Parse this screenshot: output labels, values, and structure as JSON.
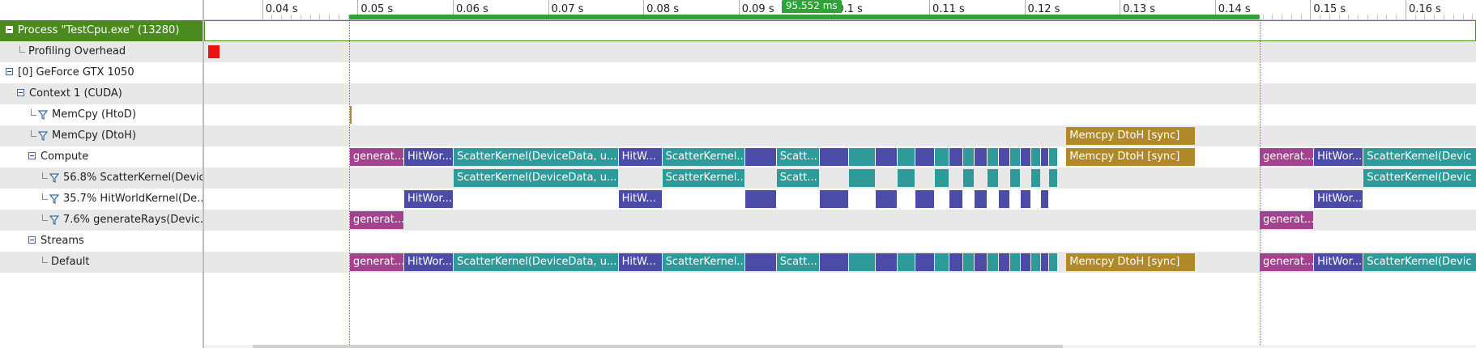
{
  "tree": {
    "rows": [
      {
        "name": "process-row",
        "label": "Process \"TestCpu.exe\" (13280)",
        "toggle": true,
        "filter": false,
        "indent": 0,
        "selected": true,
        "alt": false
      },
      {
        "name": "profiling-overhead-row",
        "label": "Profiling Overhead",
        "toggle": false,
        "filter": false,
        "indent": 1,
        "selected": false,
        "alt": true
      },
      {
        "name": "gpu-row",
        "label": "[0] GeForce GTX 1050",
        "toggle": true,
        "filter": false,
        "indent": 0,
        "selected": false,
        "alt": false
      },
      {
        "name": "context-row",
        "label": "Context 1 (CUDA)",
        "toggle": true,
        "filter": false,
        "indent": 1,
        "selected": false,
        "alt": true
      },
      {
        "name": "memcpy-htod-row",
        "label": "MemCpy (HtoD)",
        "toggle": false,
        "filter": true,
        "indent": 2,
        "selected": false,
        "alt": false
      },
      {
        "name": "memcpy-dtoh-row",
        "label": "MemCpy (DtoH)",
        "toggle": false,
        "filter": true,
        "indent": 2,
        "selected": false,
        "alt": true
      },
      {
        "name": "compute-row",
        "label": "Compute",
        "toggle": true,
        "filter": false,
        "indent": 2,
        "selected": false,
        "alt": false
      },
      {
        "name": "scatter-kernel-row",
        "label": "56.8% ScatterKernel(Devic...",
        "toggle": false,
        "filter": true,
        "indent": 3,
        "selected": false,
        "alt": true
      },
      {
        "name": "hitworld-kernel-row",
        "label": "35.7% HitWorldKernel(De...",
        "toggle": false,
        "filter": true,
        "indent": 3,
        "selected": false,
        "alt": false
      },
      {
        "name": "generate-rays-row",
        "label": "7.6% generateRays(Devic...",
        "toggle": false,
        "filter": true,
        "indent": 3,
        "selected": false,
        "alt": true
      },
      {
        "name": "streams-row",
        "label": "Streams",
        "toggle": true,
        "filter": false,
        "indent": 2,
        "selected": false,
        "alt": false
      },
      {
        "name": "default-stream-row",
        "label": "Default",
        "toggle": false,
        "filter": false,
        "indent": 3,
        "selected": false,
        "alt": true
      }
    ]
  },
  "ruler": {
    "ticks": [
      "0.04 s",
      "0.05 s",
      "0.06 s",
      "0.07 s",
      "0.08 s",
      "0.09 s",
      "0.1 s",
      "0.11 s",
      "0.12 s",
      "0.13 s",
      "0.14 s",
      "0.15 s",
      "0.16 s"
    ],
    "tick_values": [
      0.04,
      0.05,
      0.06,
      0.07,
      0.08,
      0.09,
      0.1,
      0.11,
      0.12,
      0.13,
      0.14,
      0.15,
      0.16
    ],
    "view_range_s": [
      0.0339,
      0.1674
    ],
    "selection": {
      "start_s": 0.0491,
      "end_s": 0.1447,
      "label": "95.552 ms"
    }
  },
  "colors": {
    "selected_row": "#4a8a20",
    "generate": "#a3438e",
    "hitworld": "#4c4ca8",
    "scatter": "#2f9a9a",
    "memcpy": "#b08a2a",
    "overhead": "#e11111",
    "selection": "#2fa33a"
  },
  "lanes": [
    {
      "name": "process-lane",
      "selected": true,
      "alt": false,
      "bars": []
    },
    {
      "name": "profiling-overhead-lane",
      "alt": true,
      "bars": [
        {
          "k": "oh",
          "s": 0.0343,
          "e": 0.0356,
          "t": ""
        }
      ]
    },
    {
      "name": "gpu-lane",
      "alt": false,
      "bars": []
    },
    {
      "name": "context-lane",
      "alt": true,
      "bars": []
    },
    {
      "name": "memcpy-htod-lane",
      "alt": false,
      "bars": [
        {
          "k": "m",
          "s": 0.0492,
          "e": 0.0494,
          "t": ""
        }
      ]
    },
    {
      "name": "memcpy-dtoh-lane",
      "alt": true,
      "bars": [
        {
          "k": "m",
          "s": 0.1244,
          "e": 0.138,
          "t": "Memcpy DtoH [sync]"
        }
      ]
    },
    {
      "name": "compute-lane",
      "alt": false,
      "bars": [
        {
          "k": "g",
          "s": 0.0492,
          "e": 0.0549,
          "t": "generat..."
        },
        {
          "k": "h",
          "s": 0.0549,
          "e": 0.0601,
          "t": "HitWor..."
        },
        {
          "k": "s",
          "s": 0.0601,
          "e": 0.0774,
          "t": "ScatterKernel(DeviceData, u..."
        },
        {
          "k": "h",
          "s": 0.0774,
          "e": 0.082,
          "t": "HitW..."
        },
        {
          "k": "s",
          "s": 0.082,
          "e": 0.0907,
          "t": "ScatterKernel..."
        },
        {
          "k": "h",
          "s": 0.0907,
          "e": 0.094,
          "t": ""
        },
        {
          "k": "s",
          "s": 0.094,
          "e": 0.0985,
          "t": "Scatt..."
        },
        {
          "k": "h",
          "s": 0.0985,
          "e": 0.1016,
          "t": ""
        },
        {
          "k": "s",
          "s": 0.1016,
          "e": 0.1044,
          "t": ""
        },
        {
          "k": "h",
          "s": 0.1044,
          "e": 0.1067,
          "t": ""
        },
        {
          "k": "s",
          "s": 0.1067,
          "e": 0.1086,
          "t": ""
        },
        {
          "k": "h",
          "s": 0.1086,
          "e": 0.1106,
          "t": ""
        },
        {
          "k": "s",
          "s": 0.1106,
          "e": 0.1121,
          "t": ""
        },
        {
          "k": "h",
          "s": 0.1121,
          "e": 0.1136,
          "t": ""
        },
        {
          "k": "s",
          "s": 0.1136,
          "e": 0.1148,
          "t": ""
        },
        {
          "k": "h",
          "s": 0.1148,
          "e": 0.1161,
          "t": ""
        },
        {
          "k": "s",
          "s": 0.1161,
          "e": 0.1173,
          "t": ""
        },
        {
          "k": "h",
          "s": 0.1173,
          "e": 0.1185,
          "t": ""
        },
        {
          "k": "s",
          "s": 0.1185,
          "e": 0.1196,
          "t": ""
        },
        {
          "k": "h",
          "s": 0.1196,
          "e": 0.1207,
          "t": ""
        },
        {
          "k": "s",
          "s": 0.1207,
          "e": 0.1217,
          "t": ""
        },
        {
          "k": "h",
          "s": 0.1217,
          "e": 0.1226,
          "t": ""
        },
        {
          "k": "s",
          "s": 0.1226,
          "e": 0.1235,
          "t": ""
        },
        {
          "k": "m",
          "s": 0.1244,
          "e": 0.138,
          "t": "Memcpy DtoH [sync]"
        },
        {
          "k": "g",
          "s": 0.1447,
          "e": 0.1504,
          "t": "generat..."
        },
        {
          "k": "h",
          "s": 0.1504,
          "e": 0.1556,
          "t": "HitWor..."
        },
        {
          "k": "s",
          "s": 0.1556,
          "e": 0.168,
          "t": "ScatterKernel(Devic"
        }
      ]
    },
    {
      "name": "scatter-kernel-lane",
      "alt": true,
      "bars": [
        {
          "k": "s",
          "s": 0.0601,
          "e": 0.0774,
          "t": "ScatterKernel(DeviceData, u..."
        },
        {
          "k": "s",
          "s": 0.082,
          "e": 0.0907,
          "t": "ScatterKernel..."
        },
        {
          "k": "s",
          "s": 0.094,
          "e": 0.0985,
          "t": "Scatt..."
        },
        {
          "k": "s",
          "s": 0.1016,
          "e": 0.1044,
          "t": ""
        },
        {
          "k": "s",
          "s": 0.1067,
          "e": 0.1086,
          "t": ""
        },
        {
          "k": "s",
          "s": 0.1106,
          "e": 0.1121,
          "t": ""
        },
        {
          "k": "s",
          "s": 0.1136,
          "e": 0.1148,
          "t": ""
        },
        {
          "k": "s",
          "s": 0.1161,
          "e": 0.1173,
          "t": ""
        },
        {
          "k": "s",
          "s": 0.1185,
          "e": 0.1196,
          "t": ""
        },
        {
          "k": "s",
          "s": 0.1207,
          "e": 0.1217,
          "t": ""
        },
        {
          "k": "s",
          "s": 0.1226,
          "e": 0.1235,
          "t": ""
        },
        {
          "k": "s",
          "s": 0.1556,
          "e": 0.168,
          "t": "ScatterKernel(Devic"
        }
      ]
    },
    {
      "name": "hitworld-kernel-lane",
      "alt": false,
      "bars": [
        {
          "k": "h",
          "s": 0.0549,
          "e": 0.0601,
          "t": "HitWor..."
        },
        {
          "k": "h",
          "s": 0.0774,
          "e": 0.082,
          "t": "HitW..."
        },
        {
          "k": "h",
          "s": 0.0907,
          "e": 0.094,
          "t": ""
        },
        {
          "k": "h",
          "s": 0.0985,
          "e": 0.1016,
          "t": ""
        },
        {
          "k": "h",
          "s": 0.1044,
          "e": 0.1067,
          "t": ""
        },
        {
          "k": "h",
          "s": 0.1086,
          "e": 0.1106,
          "t": ""
        },
        {
          "k": "h",
          "s": 0.1121,
          "e": 0.1136,
          "t": ""
        },
        {
          "k": "h",
          "s": 0.1148,
          "e": 0.1161,
          "t": ""
        },
        {
          "k": "h",
          "s": 0.1173,
          "e": 0.1185,
          "t": ""
        },
        {
          "k": "h",
          "s": 0.1196,
          "e": 0.1207,
          "t": ""
        },
        {
          "k": "h",
          "s": 0.1217,
          "e": 0.1226,
          "t": ""
        },
        {
          "k": "h",
          "s": 0.1504,
          "e": 0.1556,
          "t": "HitWor..."
        }
      ]
    },
    {
      "name": "generate-rays-lane",
      "alt": true,
      "bars": [
        {
          "k": "g",
          "s": 0.0492,
          "e": 0.0549,
          "t": "generat..."
        },
        {
          "k": "g",
          "s": 0.1447,
          "e": 0.1504,
          "t": "generat..."
        }
      ]
    },
    {
      "name": "streams-lane",
      "alt": false,
      "bars": []
    },
    {
      "name": "default-stream-lane",
      "alt": true,
      "bars": [
        {
          "k": "g",
          "s": 0.0492,
          "e": 0.0549,
          "t": "generat..."
        },
        {
          "k": "h",
          "s": 0.0549,
          "e": 0.0601,
          "t": "HitWor..."
        },
        {
          "k": "s",
          "s": 0.0601,
          "e": 0.0774,
          "t": "ScatterKernel(DeviceData, u..."
        },
        {
          "k": "h",
          "s": 0.0774,
          "e": 0.082,
          "t": "HitW..."
        },
        {
          "k": "s",
          "s": 0.082,
          "e": 0.0907,
          "t": "ScatterKernel..."
        },
        {
          "k": "h",
          "s": 0.0907,
          "e": 0.094,
          "t": ""
        },
        {
          "k": "s",
          "s": 0.094,
          "e": 0.0985,
          "t": "Scatt..."
        },
        {
          "k": "h",
          "s": 0.0985,
          "e": 0.1016,
          "t": ""
        },
        {
          "k": "s",
          "s": 0.1016,
          "e": 0.1044,
          "t": ""
        },
        {
          "k": "h",
          "s": 0.1044,
          "e": 0.1067,
          "t": ""
        },
        {
          "k": "s",
          "s": 0.1067,
          "e": 0.1086,
          "t": ""
        },
        {
          "k": "h",
          "s": 0.1086,
          "e": 0.1106,
          "t": ""
        },
        {
          "k": "s",
          "s": 0.1106,
          "e": 0.1121,
          "t": ""
        },
        {
          "k": "h",
          "s": 0.1121,
          "e": 0.1136,
          "t": ""
        },
        {
          "k": "s",
          "s": 0.1136,
          "e": 0.1148,
          "t": ""
        },
        {
          "k": "h",
          "s": 0.1148,
          "e": 0.1161,
          "t": ""
        },
        {
          "k": "s",
          "s": 0.1161,
          "e": 0.1173,
          "t": ""
        },
        {
          "k": "h",
          "s": 0.1173,
          "e": 0.1185,
          "t": ""
        },
        {
          "k": "s",
          "s": 0.1185,
          "e": 0.1196,
          "t": ""
        },
        {
          "k": "h",
          "s": 0.1196,
          "e": 0.1207,
          "t": ""
        },
        {
          "k": "s",
          "s": 0.1207,
          "e": 0.1217,
          "t": ""
        },
        {
          "k": "h",
          "s": 0.1217,
          "e": 0.1226,
          "t": ""
        },
        {
          "k": "s",
          "s": 0.1226,
          "e": 0.1235,
          "t": ""
        },
        {
          "k": "m",
          "s": 0.1244,
          "e": 0.138,
          "t": "Memcpy DtoH [sync]"
        },
        {
          "k": "g",
          "s": 0.1447,
          "e": 0.1504,
          "t": "generat..."
        },
        {
          "k": "h",
          "s": 0.1504,
          "e": 0.1556,
          "t": "HitWor..."
        },
        {
          "k": "s",
          "s": 0.1556,
          "e": 0.168,
          "t": "ScatterKernel(Devic"
        }
      ]
    }
  ]
}
